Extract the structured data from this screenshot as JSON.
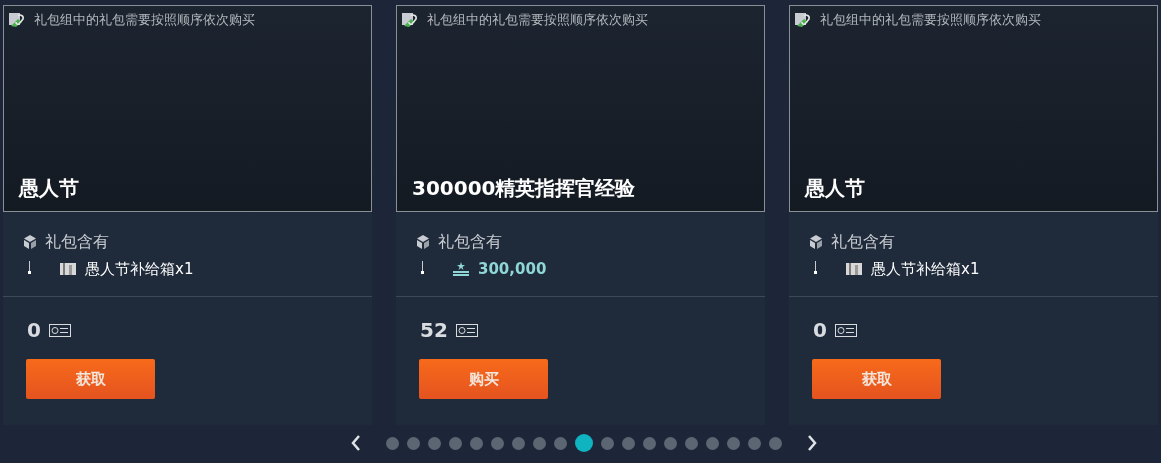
{
  "cards": [
    {
      "image_alt": "礼包组中的礼包需要按照顺序依次购买",
      "title": "愚人节",
      "contents_label": "礼包含有",
      "items": [
        {
          "kind": "crate",
          "text": "愚人节补给箱x1"
        }
      ],
      "price": "0",
      "button": "获取"
    },
    {
      "image_alt": "礼包组中的礼包需要按照顺序依次购买",
      "title": "300000精英指挥官经验",
      "contents_label": "礼包含有",
      "items": [
        {
          "kind": "xp",
          "text": "300,000"
        }
      ],
      "price": "52",
      "button": "购买"
    },
    {
      "image_alt": "礼包组中的礼包需要按照顺序依次购买",
      "title": "愚人节",
      "contents_label": "礼包含有",
      "items": [
        {
          "kind": "crate",
          "text": "愚人节补给箱x1"
        }
      ],
      "price": "0",
      "button": "获取"
    }
  ],
  "pager": {
    "dots": [
      {
        "selected": false
      },
      {
        "selected": false
      },
      {
        "selected": false
      },
      {
        "selected": false
      },
      {
        "selected": false
      },
      {
        "selected": false
      },
      {
        "selected": false
      },
      {
        "selected": false
      },
      {
        "selected": false
      },
      {
        "selected": true
      },
      {
        "selected": false
      },
      {
        "selected": false
      },
      {
        "selected": false
      },
      {
        "selected": false
      },
      {
        "selected": false
      },
      {
        "selected": false
      },
      {
        "selected": false
      },
      {
        "selected": false
      },
      {
        "selected": false
      }
    ]
  }
}
